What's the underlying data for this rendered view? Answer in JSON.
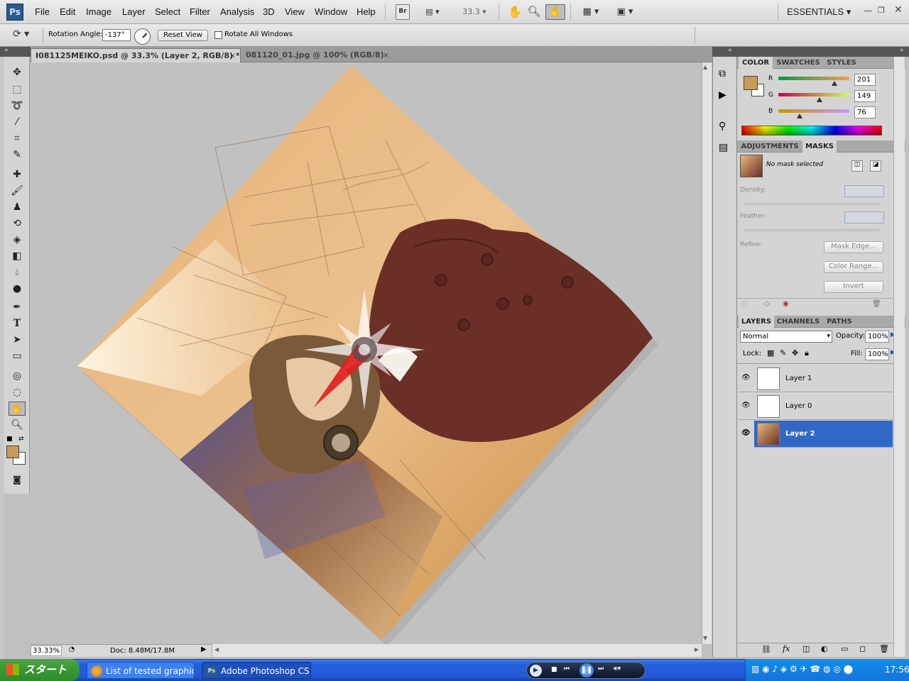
{
  "menubar": {
    "logo": "Ps",
    "items": [
      "File",
      "Edit",
      "Image",
      "Layer",
      "Select",
      "Filter",
      "Analysis",
      "3D",
      "View",
      "Window",
      "Help"
    ],
    "bridge_label": "Br",
    "zoom_value": "33.3",
    "workspace": "ESSENTIALS"
  },
  "options": {
    "rotation_label": "Rotation Angle:",
    "rotation_value": "-137°",
    "reset_label": "Reset View",
    "rotate_all_label": "Rotate All Windows"
  },
  "tabs": [
    {
      "label": "I081125MEIKO.psd @ 33.3% (Layer 2, RGB/8) *",
      "close": "×"
    },
    {
      "label": "081120_01.jpg @ 100% (RGB/8)",
      "close": "×"
    }
  ],
  "status": {
    "zoom": "33.33%",
    "doc": "Doc: 8.48M/17.8M"
  },
  "color_panel": {
    "tabs": [
      "COLOR",
      "SWATCHES",
      "STYLES"
    ],
    "foreground": "#c99a55",
    "channels": [
      {
        "label": "R",
        "value": "201",
        "level": 0.79
      },
      {
        "label": "G",
        "value": "149",
        "level": 0.58
      },
      {
        "label": "B",
        "value": "76",
        "level": 0.3
      }
    ]
  },
  "masks_panel": {
    "tabs": [
      "ADJUSTMENTS",
      "MASKS"
    ],
    "status": "No mask selected",
    "density_label": "Density:",
    "feather_label": "Feather:",
    "refine_label": "Refine:",
    "buttons": [
      "Mask Edge...",
      "Color Range...",
      "Invert"
    ]
  },
  "layers_panel": {
    "tabs": [
      "LAYERS",
      "CHANNELS",
      "PATHS"
    ],
    "blend_mode": "Normal",
    "opacity_label": "Opacity:",
    "opacity": "100%",
    "lock_label": "Lock:",
    "fill_label": "Fill:",
    "fill": "100%",
    "layers": [
      {
        "name": "Layer 1",
        "selected": false
      },
      {
        "name": "Layer 0",
        "selected": false
      },
      {
        "name": "Layer 2",
        "selected": true
      }
    ]
  },
  "taskbar": {
    "start_label": "スタート",
    "buttons": [
      "List of tested graphic...",
      "Adobe Photoshop CS..."
    ],
    "clock": "17:56"
  }
}
